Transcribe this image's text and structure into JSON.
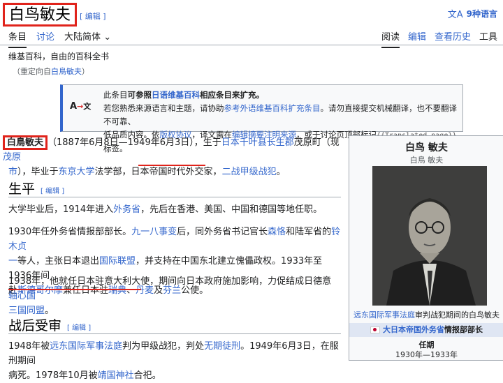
{
  "header": {
    "title": "白鸟敏夫",
    "edit": "[ 编辑 ]",
    "languages": "9种语言"
  },
  "tabs_left": [
    "条目",
    "讨论",
    "大陆简体"
  ],
  "tabs_right": [
    "阅读",
    "编辑",
    "查看历史",
    "工具"
  ],
  "site_sub": "维基百科，自由的百科全书",
  "redirect": {
    "prefix": "（重定向自",
    "link": "白鳥敏夫",
    "suffix": "）"
  },
  "hatnote": {
    "line1_a": "此条目",
    "line1_b": "可参照",
    "line1_c": "日语维基百科",
    "line1_d": "相应条目来扩充。",
    "line2_a": "若您熟悉来源语言和主题，请协助",
    "line2_link": "参考外语维基百科扩充条目",
    "line2_b": "。请勿直接提交机械翻译，也不要翻译不可靠、",
    "line3_a": "低品质内容。依",
    "line3_link1": "版权协议",
    "line3_b": "，译文需在",
    "line3_link2": "编辑摘要注明来源",
    "line3_c": "，或于讨论页顶部标记",
    "line3_code": "{{Translated page}}",
    "line3_d": "标签。",
    "icon": "A→文"
  },
  "lead": {
    "name": "白鳥敏夫",
    "t1": "（1887年6月8日—1949年6月3日），生于",
    "l1": "日本千叶县长生郡",
    "t2": "茂原町（现",
    "l2": "茂原",
    "l3": "市",
    "t3": "），毕业于",
    "l4": "东京大学",
    "t4": "法学部，日本帝国时代外交家，",
    "l5": "二战甲级战犯",
    "t5": "。"
  },
  "section1": {
    "title": "生平",
    "edit": "[ 编辑 ]"
  },
  "p1": {
    "t1": "大学毕业后，1914年进入",
    "l1": "外务省",
    "t2": "，先后在香港、美国、中国和德国等地任职。"
  },
  "p2": {
    "t1": "1930年任外务省情报部部长。",
    "l1": "九一八事变",
    "t2": "后，同外务省书记官长",
    "l2": "森恪",
    "t3": "和陆军省的",
    "l3": "铃木贞",
    "l3b": "一",
    "t4": "等人，主张日本退出",
    "l4": "国际联盟",
    "t5": "，并支持在中国东北建立傀儡政权。1933年至1936年间",
    "t6": "赴",
    "l5": "斯德哥尔摩",
    "t7": "兼任日本驻",
    "l6": "瑞典",
    "t8": "、",
    "l7": "丹麦",
    "t9": "及",
    "l8": "芬兰",
    "t10": "公使。"
  },
  "p3": {
    "t1": "1938年，他就任日本驻意大利大使，期间向日本政府施加影响，力促结成日德意",
    "l1": "轴心国",
    "l1b": "三国同盟",
    "t2": "。"
  },
  "section2": {
    "title": "战后受审",
    "edit": "[ 编辑 ]"
  },
  "p4": {
    "t1": "1948年被",
    "l1": "远东国际军事法庭",
    "t2": "判为甲级战犯，判处",
    "l2": "无期徒刑",
    "t3": "。1949年6月3日，在服刑期间",
    "t4": "病死。1978年10月被",
    "l3": "靖国神社",
    "t5": "合祀。"
  },
  "infobox": {
    "title": "白鸟 敏夫",
    "subtitle": "白鳥 敏夫",
    "caption_link": "远东国际军事法庭",
    "caption_rest": "审判战犯期间的白鸟敏夫",
    "band_link": "大日本帝国外务省",
    "band_rest": "情报部部长",
    "label": "任期",
    "value": "1930年—1933年"
  }
}
